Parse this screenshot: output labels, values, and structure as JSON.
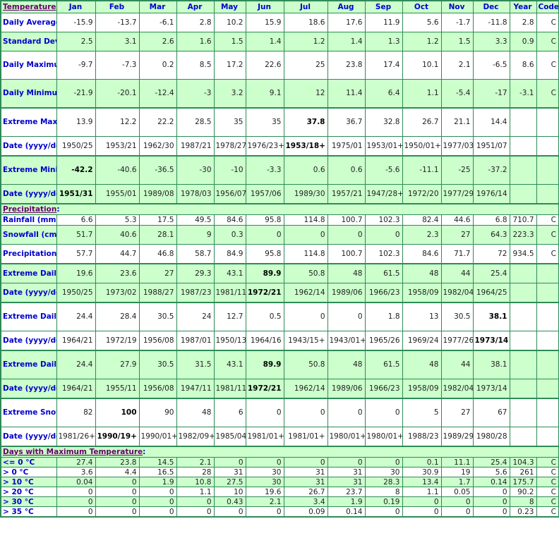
{
  "header": {
    "section_title": "Temperature",
    "columns": [
      "Jan",
      "Feb",
      "Mar",
      "Apr",
      "May",
      "Jun",
      "Jul",
      "Aug",
      "Sep",
      "Oct",
      "Nov",
      "Dec",
      "Year",
      "Code"
    ]
  },
  "sections": {
    "temperature": "Temperature",
    "precipitation": "Precipitation",
    "days_max_temp": "Days with Maximum Temperature"
  },
  "colors": {
    "border": "#2e8b57",
    "highlight_row": "#ccffcc",
    "label_text": "#0000cc",
    "section_title": "#660066"
  },
  "rows": [
    {
      "id": "daily-average",
      "label": "Daily Average (°C)",
      "cells": [
        "-15.9",
        "-13.7",
        "-6.1",
        "2.8",
        "10.2",
        "15.9",
        "18.6",
        "17.6",
        "11.9",
        "5.6",
        "-1.7",
        "-11.8",
        "2.8",
        "C"
      ],
      "bold": []
    },
    {
      "id": "standard-deviation",
      "label": "Standard Deviation",
      "cells": [
        "2.5",
        "3.1",
        "2.6",
        "1.6",
        "1.5",
        "1.4",
        "1.2",
        "1.4",
        "1.3",
        "1.2",
        "1.5",
        "3.3",
        "0.9",
        "C"
      ],
      "bold": []
    },
    {
      "id": "daily-maximum",
      "label": "Daily Maximum (°C)",
      "cells": [
        "-9.7",
        "-7.3",
        "0.2",
        "8.5",
        "17.2",
        "22.6",
        "25",
        "23.8",
        "17.4",
        "10.1",
        "2.1",
        "-6.5",
        "8.6",
        "C"
      ],
      "bold": []
    },
    {
      "id": "daily-minimum",
      "label": "Daily Minimum (°C)",
      "cells": [
        "-21.9",
        "-20.1",
        "-12.4",
        "-3",
        "3.2",
        "9.1",
        "12",
        "11.4",
        "6.4",
        "1.1",
        "-5.4",
        "-17",
        "-3.1",
        "C"
      ],
      "bold": []
    },
    {
      "id": "extreme-maximum",
      "label": "Extreme Maximum (°C)",
      "cells": [
        "13.9",
        "12.2",
        "22.2",
        "28.5",
        "35",
        "35",
        "37.8",
        "36.7",
        "32.8",
        "26.7",
        "21.1",
        "14.4",
        "",
        ""
      ],
      "bold": [
        6
      ]
    },
    {
      "id": "extreme-maximum-date",
      "label": "Date (yyyy/dd)",
      "cells": [
        "1950/25",
        "1953/21",
        "1962/30",
        "1987/21",
        "1978/27",
        "1976/23+",
        "1953/18+",
        "1975/01",
        "1953/01+",
        "1950/01+",
        "1977/03",
        "1951/07",
        "",
        ""
      ],
      "bold": [
        6
      ]
    },
    {
      "id": "extreme-minimum",
      "label": "Extreme Minimum (°C)",
      "cells": [
        "-42.2",
        "-40.6",
        "-36.5",
        "-30",
        "-10",
        "-3.3",
        "0.6",
        "0.6",
        "-5.6",
        "-11.1",
        "-25",
        "-37.2",
        "",
        ""
      ],
      "bold": [
        0
      ]
    },
    {
      "id": "extreme-minimum-date",
      "label": "Date (yyyy/dd)",
      "cells": [
        "1951/31",
        "1955/01",
        "1989/08",
        "1978/03",
        "1956/07",
        "1957/06",
        "1989/30",
        "1957/21",
        "1947/28+",
        "1972/20",
        "1977/29",
        "1976/14",
        "",
        ""
      ],
      "bold": [
        0
      ]
    },
    {
      "id": "rainfall",
      "label": "Rainfall (mm)",
      "cells": [
        "6.6",
        "5.3",
        "17.5",
        "49.5",
        "84.6",
        "95.8",
        "114.8",
        "100.7",
        "102.3",
        "82.4",
        "44.6",
        "6.8",
        "710.7",
        "C"
      ],
      "bold": []
    },
    {
      "id": "snowfall",
      "label": "Snowfall (cm)",
      "cells": [
        "51.7",
        "40.6",
        "28.1",
        "9",
        "0.3",
        "0",
        "0",
        "0",
        "0",
        "2.3",
        "27",
        "64.3",
        "223.3",
        "C"
      ],
      "bold": []
    },
    {
      "id": "precipitation",
      "label": "Precipitation (mm)",
      "cells": [
        "57.7",
        "44.7",
        "46.8",
        "58.7",
        "84.9",
        "95.8",
        "114.8",
        "100.7",
        "102.3",
        "84.6",
        "71.7",
        "72",
        "934.5",
        "C"
      ],
      "bold": []
    },
    {
      "id": "extreme-daily-rainfall",
      "label": "Extreme Daily Rainfall (mm)",
      "cells": [
        "19.6",
        "23.6",
        "27",
        "29.3",
        "43.1",
        "89.9",
        "50.8",
        "48",
        "61.5",
        "48",
        "44",
        "25.4",
        "",
        ""
      ],
      "bold": [
        5
      ]
    },
    {
      "id": "extreme-daily-rainfall-date",
      "label": "Date (yyyy/dd)",
      "cells": [
        "1950/25",
        "1973/02",
        "1988/27",
        "1987/23",
        "1981/11",
        "1972/21",
        "1962/14",
        "1989/06",
        "1966/23",
        "1958/09",
        "1982/04",
        "1964/25",
        "",
        ""
      ],
      "bold": [
        5
      ]
    },
    {
      "id": "extreme-daily-snowfall",
      "label": "Extreme Daily Snowfall (cm)",
      "cells": [
        "24.4",
        "28.4",
        "30.5",
        "24",
        "12.7",
        "0.5",
        "0",
        "0",
        "1.8",
        "13",
        "30.5",
        "38.1",
        "",
        ""
      ],
      "bold": [
        11
      ]
    },
    {
      "id": "extreme-daily-snowfall-date",
      "label": "Date (yyyy/dd)",
      "cells": [
        "1964/21",
        "1972/19",
        "1956/08",
        "1987/01",
        "1950/13",
        "1964/16",
        "1943/15+",
        "1943/01+",
        "1965/26",
        "1969/24",
        "1977/26",
        "1973/14",
        "",
        ""
      ],
      "bold": [
        11
      ]
    },
    {
      "id": "extreme-daily-precipitation",
      "label": "Extreme Daily Precipitation (mm)",
      "cells": [
        "24.4",
        "27.9",
        "30.5",
        "31.5",
        "43.1",
        "89.9",
        "50.8",
        "48",
        "61.5",
        "48",
        "44",
        "38.1",
        "",
        ""
      ],
      "bold": [
        5
      ]
    },
    {
      "id": "extreme-daily-precipitation-date",
      "label": "Date (yyyy/dd)",
      "cells": [
        "1964/21",
        "1955/11",
        "1956/08",
        "1947/11",
        "1981/11",
        "1972/21",
        "1962/14",
        "1989/06",
        "1966/23",
        "1958/09",
        "1982/04",
        "1973/14",
        "",
        ""
      ],
      "bold": [
        5
      ]
    },
    {
      "id": "extreme-snow-depth",
      "label": "Extreme Snow Depth (cm)",
      "cells": [
        "82",
        "100",
        "90",
        "48",
        "6",
        "0",
        "0",
        "0",
        "0",
        "5",
        "27",
        "67",
        "",
        ""
      ],
      "bold": [
        1
      ]
    },
    {
      "id": "extreme-snow-depth-date",
      "label": "Date (yyyy/dd)",
      "cells": [
        "1981/26+",
        "1990/19+",
        "1990/01+",
        "1982/09+",
        "1985/04",
        "1981/01+",
        "1981/01+",
        "1980/01+",
        "1980/01+",
        "1988/23",
        "1989/29",
        "1980/28",
        "",
        ""
      ],
      "bold": [
        1
      ]
    },
    {
      "id": "days-le-0",
      "label": "<= 0 °C",
      "cells": [
        "27.4",
        "23.8",
        "14.5",
        "2.1",
        "0",
        "0",
        "0",
        "0",
        "0",
        "0.1",
        "11.1",
        "25.4",
        "104.3",
        "C"
      ],
      "bold": []
    },
    {
      "id": "days-gt-0",
      "label": "> 0 °C",
      "cells": [
        "3.6",
        "4.4",
        "16.5",
        "28",
        "31",
        "30",
        "31",
        "31",
        "30",
        "30.9",
        "19",
        "5.6",
        "261",
        "C"
      ],
      "bold": []
    },
    {
      "id": "days-gt-10",
      "label": "> 10 °C",
      "cells": [
        "0.04",
        "0",
        "1.9",
        "10.8",
        "27.5",
        "30",
        "31",
        "31",
        "28.3",
        "13.4",
        "1.7",
        "0.14",
        "175.7",
        "C"
      ],
      "bold": []
    },
    {
      "id": "days-gt-20",
      "label": "> 20 °C",
      "cells": [
        "0",
        "0",
        "0",
        "1.1",
        "10",
        "19.6",
        "26.7",
        "23.7",
        "8",
        "1.1",
        "0.05",
        "0",
        "90.2",
        "C"
      ],
      "bold": []
    },
    {
      "id": "days-gt-30",
      "label": "> 30 °C",
      "cells": [
        "0",
        "0",
        "0",
        "0",
        "0.43",
        "2.1",
        "3.4",
        "1.9",
        "0.19",
        "0",
        "0",
        "0",
        "8",
        "C"
      ],
      "bold": []
    },
    {
      "id": "days-gt-35",
      "label": "> 35 °C",
      "cells": [
        "0",
        "0",
        "0",
        "0",
        "0",
        "0",
        "0.09",
        "0.14",
        "0",
        "0",
        "0",
        "0",
        "0.23",
        "C"
      ],
      "bold": []
    }
  ]
}
